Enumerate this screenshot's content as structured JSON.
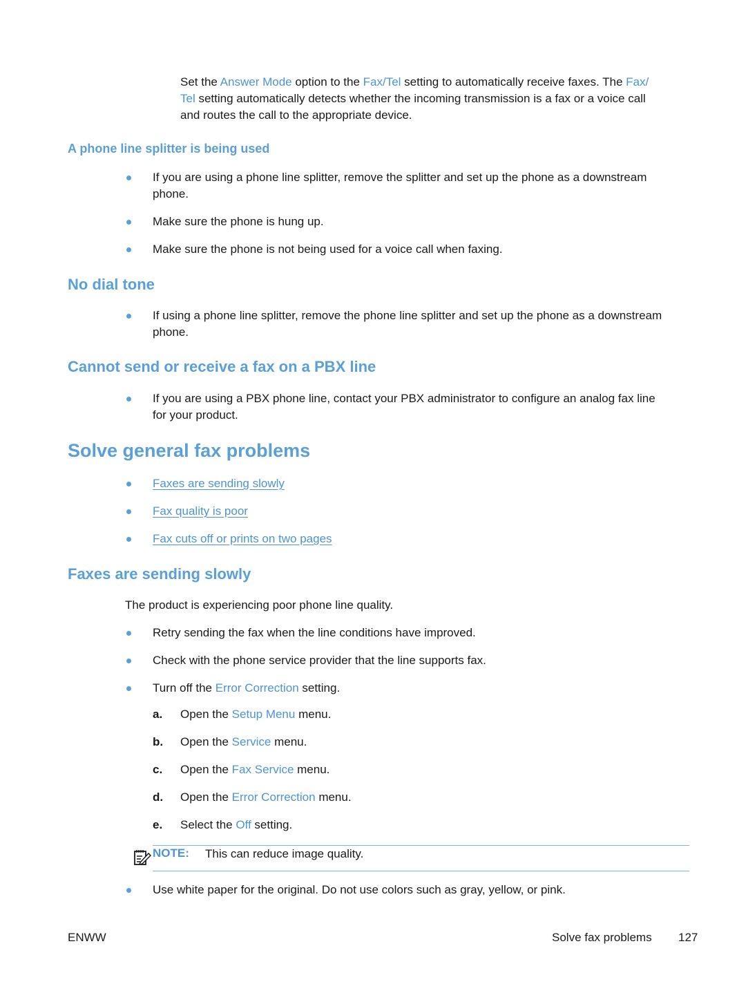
{
  "intro": {
    "parts": [
      {
        "t": "Set the ",
        "ui": false
      },
      {
        "t": "Answer Mode",
        "ui": true
      },
      {
        "t": " option to the ",
        "ui": false
      },
      {
        "t": "Fax/Tel",
        "ui": true
      },
      {
        "t": " setting to automatically receive faxes. The ",
        "ui": false
      },
      {
        "t": "Fax/",
        "ui": true
      }
    ],
    "line2_parts": [
      {
        "t": "Tel",
        "ui": true
      },
      {
        "t": " setting automatically detects whether the incoming transmission is a fax or a voice call",
        "ui": false
      }
    ],
    "line3": "and routes the call to the appropriate device."
  },
  "splitter": {
    "heading": "A phone line splitter is being used",
    "items": [
      "If you are using a phone line splitter, remove the splitter and set up the phone as a downstream",
      "phone.",
      "Make sure the phone is hung up.",
      "Make sure the phone is not being used for a voice call when faxing."
    ]
  },
  "no_dial_tone": {
    "heading": "No dial tone",
    "item_line1": "If using a phone line splitter, remove the phone line splitter and set up the phone as a downstream",
    "item_line2": "phone."
  },
  "pbx": {
    "heading": "Cannot send or receive a fax on a PBX line",
    "item_line1": "If you are using a PBX phone line, contact your PBX administrator to configure an analog fax line",
    "item_line2": "for your product."
  },
  "general": {
    "heading": "Solve general fax problems",
    "links": [
      "Faxes are sending slowly",
      "Fax quality is poor",
      "Fax cuts off or prints on two pages"
    ]
  },
  "slow": {
    "heading": "Faxes are sending slowly",
    "intro": "The product is experiencing poor phone line quality.",
    "item1": "Retry sending the fax when the line conditions have improved.",
    "item2": "Check with the phone service provider that the line supports fax.",
    "item3_pre": "Turn off the ",
    "item3_ui": "Error Correction",
    "item3_post": " setting.",
    "steps": [
      {
        "letter": "a.",
        "pre": "Open the ",
        "ui": "Setup Menu",
        "post": " menu."
      },
      {
        "letter": "b.",
        "pre": "Open the ",
        "ui": "Service",
        "post": " menu."
      },
      {
        "letter": "c.",
        "pre": "Open the ",
        "ui": "Fax Service",
        "post": " menu."
      },
      {
        "letter": "d.",
        "pre": "Open the ",
        "ui": "Error Correction",
        "post": " menu."
      },
      {
        "letter": "e.",
        "pre": "Select the ",
        "ui": "Off",
        "post": " setting."
      }
    ],
    "note_label": "NOTE:",
    "note_text": "This can reduce image quality.",
    "item4": "Use white paper for the original. Do not use colors such as gray, yellow, or pink."
  },
  "footer": {
    "left": "ENWW",
    "section": "Solve fax problems",
    "page": "127"
  },
  "colors": {
    "accent": "#5a9fd6",
    "link": "#4d94d3",
    "text": "#1a1a1a"
  }
}
